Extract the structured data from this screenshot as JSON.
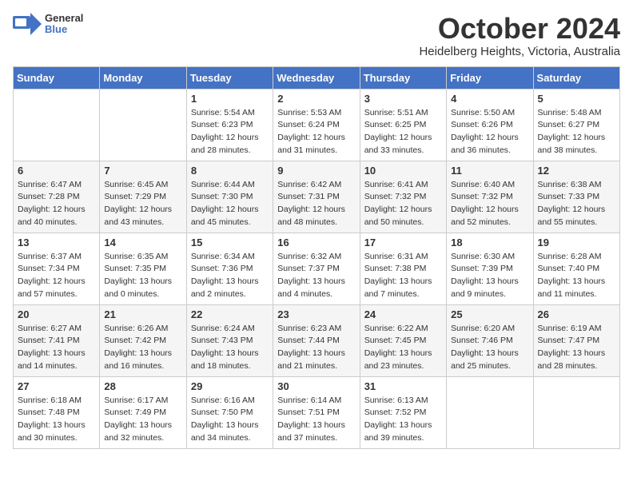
{
  "header": {
    "logo_text_general": "General",
    "logo_text_blue": "Blue",
    "month_title": "October 2024",
    "subtitle": "Heidelberg Heights, Victoria, Australia"
  },
  "days_of_week": [
    "Sunday",
    "Monday",
    "Tuesday",
    "Wednesday",
    "Thursday",
    "Friday",
    "Saturday"
  ],
  "weeks": [
    [
      {
        "day": "",
        "info": ""
      },
      {
        "day": "",
        "info": ""
      },
      {
        "day": "1",
        "info": "Sunrise: 5:54 AM\nSunset: 6:23 PM\nDaylight: 12 hours and 28 minutes."
      },
      {
        "day": "2",
        "info": "Sunrise: 5:53 AM\nSunset: 6:24 PM\nDaylight: 12 hours and 31 minutes."
      },
      {
        "day": "3",
        "info": "Sunrise: 5:51 AM\nSunset: 6:25 PM\nDaylight: 12 hours and 33 minutes."
      },
      {
        "day": "4",
        "info": "Sunrise: 5:50 AM\nSunset: 6:26 PM\nDaylight: 12 hours and 36 minutes."
      },
      {
        "day": "5",
        "info": "Sunrise: 5:48 AM\nSunset: 6:27 PM\nDaylight: 12 hours and 38 minutes."
      }
    ],
    [
      {
        "day": "6",
        "info": "Sunrise: 6:47 AM\nSunset: 7:28 PM\nDaylight: 12 hours and 40 minutes."
      },
      {
        "day": "7",
        "info": "Sunrise: 6:45 AM\nSunset: 7:29 PM\nDaylight: 12 hours and 43 minutes."
      },
      {
        "day": "8",
        "info": "Sunrise: 6:44 AM\nSunset: 7:30 PM\nDaylight: 12 hours and 45 minutes."
      },
      {
        "day": "9",
        "info": "Sunrise: 6:42 AM\nSunset: 7:31 PM\nDaylight: 12 hours and 48 minutes."
      },
      {
        "day": "10",
        "info": "Sunrise: 6:41 AM\nSunset: 7:32 PM\nDaylight: 12 hours and 50 minutes."
      },
      {
        "day": "11",
        "info": "Sunrise: 6:40 AM\nSunset: 7:32 PM\nDaylight: 12 hours and 52 minutes."
      },
      {
        "day": "12",
        "info": "Sunrise: 6:38 AM\nSunset: 7:33 PM\nDaylight: 12 hours and 55 minutes."
      }
    ],
    [
      {
        "day": "13",
        "info": "Sunrise: 6:37 AM\nSunset: 7:34 PM\nDaylight: 12 hours and 57 minutes."
      },
      {
        "day": "14",
        "info": "Sunrise: 6:35 AM\nSunset: 7:35 PM\nDaylight: 13 hours and 0 minutes."
      },
      {
        "day": "15",
        "info": "Sunrise: 6:34 AM\nSunset: 7:36 PM\nDaylight: 13 hours and 2 minutes."
      },
      {
        "day": "16",
        "info": "Sunrise: 6:32 AM\nSunset: 7:37 PM\nDaylight: 13 hours and 4 minutes."
      },
      {
        "day": "17",
        "info": "Sunrise: 6:31 AM\nSunset: 7:38 PM\nDaylight: 13 hours and 7 minutes."
      },
      {
        "day": "18",
        "info": "Sunrise: 6:30 AM\nSunset: 7:39 PM\nDaylight: 13 hours and 9 minutes."
      },
      {
        "day": "19",
        "info": "Sunrise: 6:28 AM\nSunset: 7:40 PM\nDaylight: 13 hours and 11 minutes."
      }
    ],
    [
      {
        "day": "20",
        "info": "Sunrise: 6:27 AM\nSunset: 7:41 PM\nDaylight: 13 hours and 14 minutes."
      },
      {
        "day": "21",
        "info": "Sunrise: 6:26 AM\nSunset: 7:42 PM\nDaylight: 13 hours and 16 minutes."
      },
      {
        "day": "22",
        "info": "Sunrise: 6:24 AM\nSunset: 7:43 PM\nDaylight: 13 hours and 18 minutes."
      },
      {
        "day": "23",
        "info": "Sunrise: 6:23 AM\nSunset: 7:44 PM\nDaylight: 13 hours and 21 minutes."
      },
      {
        "day": "24",
        "info": "Sunrise: 6:22 AM\nSunset: 7:45 PM\nDaylight: 13 hours and 23 minutes."
      },
      {
        "day": "25",
        "info": "Sunrise: 6:20 AM\nSunset: 7:46 PM\nDaylight: 13 hours and 25 minutes."
      },
      {
        "day": "26",
        "info": "Sunrise: 6:19 AM\nSunset: 7:47 PM\nDaylight: 13 hours and 28 minutes."
      }
    ],
    [
      {
        "day": "27",
        "info": "Sunrise: 6:18 AM\nSunset: 7:48 PM\nDaylight: 13 hours and 30 minutes."
      },
      {
        "day": "28",
        "info": "Sunrise: 6:17 AM\nSunset: 7:49 PM\nDaylight: 13 hours and 32 minutes."
      },
      {
        "day": "29",
        "info": "Sunrise: 6:16 AM\nSunset: 7:50 PM\nDaylight: 13 hours and 34 minutes."
      },
      {
        "day": "30",
        "info": "Sunrise: 6:14 AM\nSunset: 7:51 PM\nDaylight: 13 hours and 37 minutes."
      },
      {
        "day": "31",
        "info": "Sunrise: 6:13 AM\nSunset: 7:52 PM\nDaylight: 13 hours and 39 minutes."
      },
      {
        "day": "",
        "info": ""
      },
      {
        "day": "",
        "info": ""
      }
    ]
  ]
}
